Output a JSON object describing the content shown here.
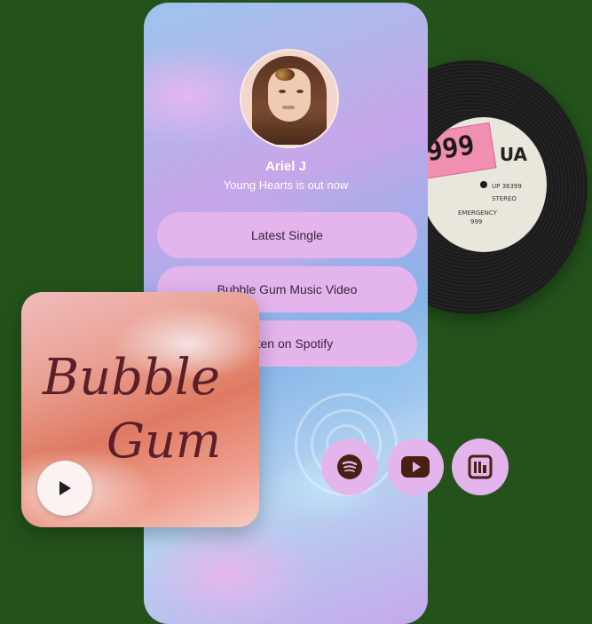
{
  "vinyl": {
    "sticker_text": "999",
    "brand": "UA",
    "label_lines": [
      "EMERGENCY",
      "999",
      "UP 36399",
      "STEREO"
    ]
  },
  "profile": {
    "name": "Ariel J",
    "tagline": "Young Hearts is out now"
  },
  "links": [
    {
      "label": "Latest Single"
    },
    {
      "label": "Bubble Gum Music Video"
    },
    {
      "label": "Listen on Spotify"
    }
  ],
  "social_icons": [
    {
      "name": "spotify-icon"
    },
    {
      "name": "youtube-icon"
    },
    {
      "name": "bandcamp-icon"
    }
  ],
  "album": {
    "title_line1": "Bubble",
    "title_line2": "Gum"
  },
  "colors": {
    "background": "#23521b",
    "button": "#e3b5ec",
    "icon": "#4a1f12"
  }
}
